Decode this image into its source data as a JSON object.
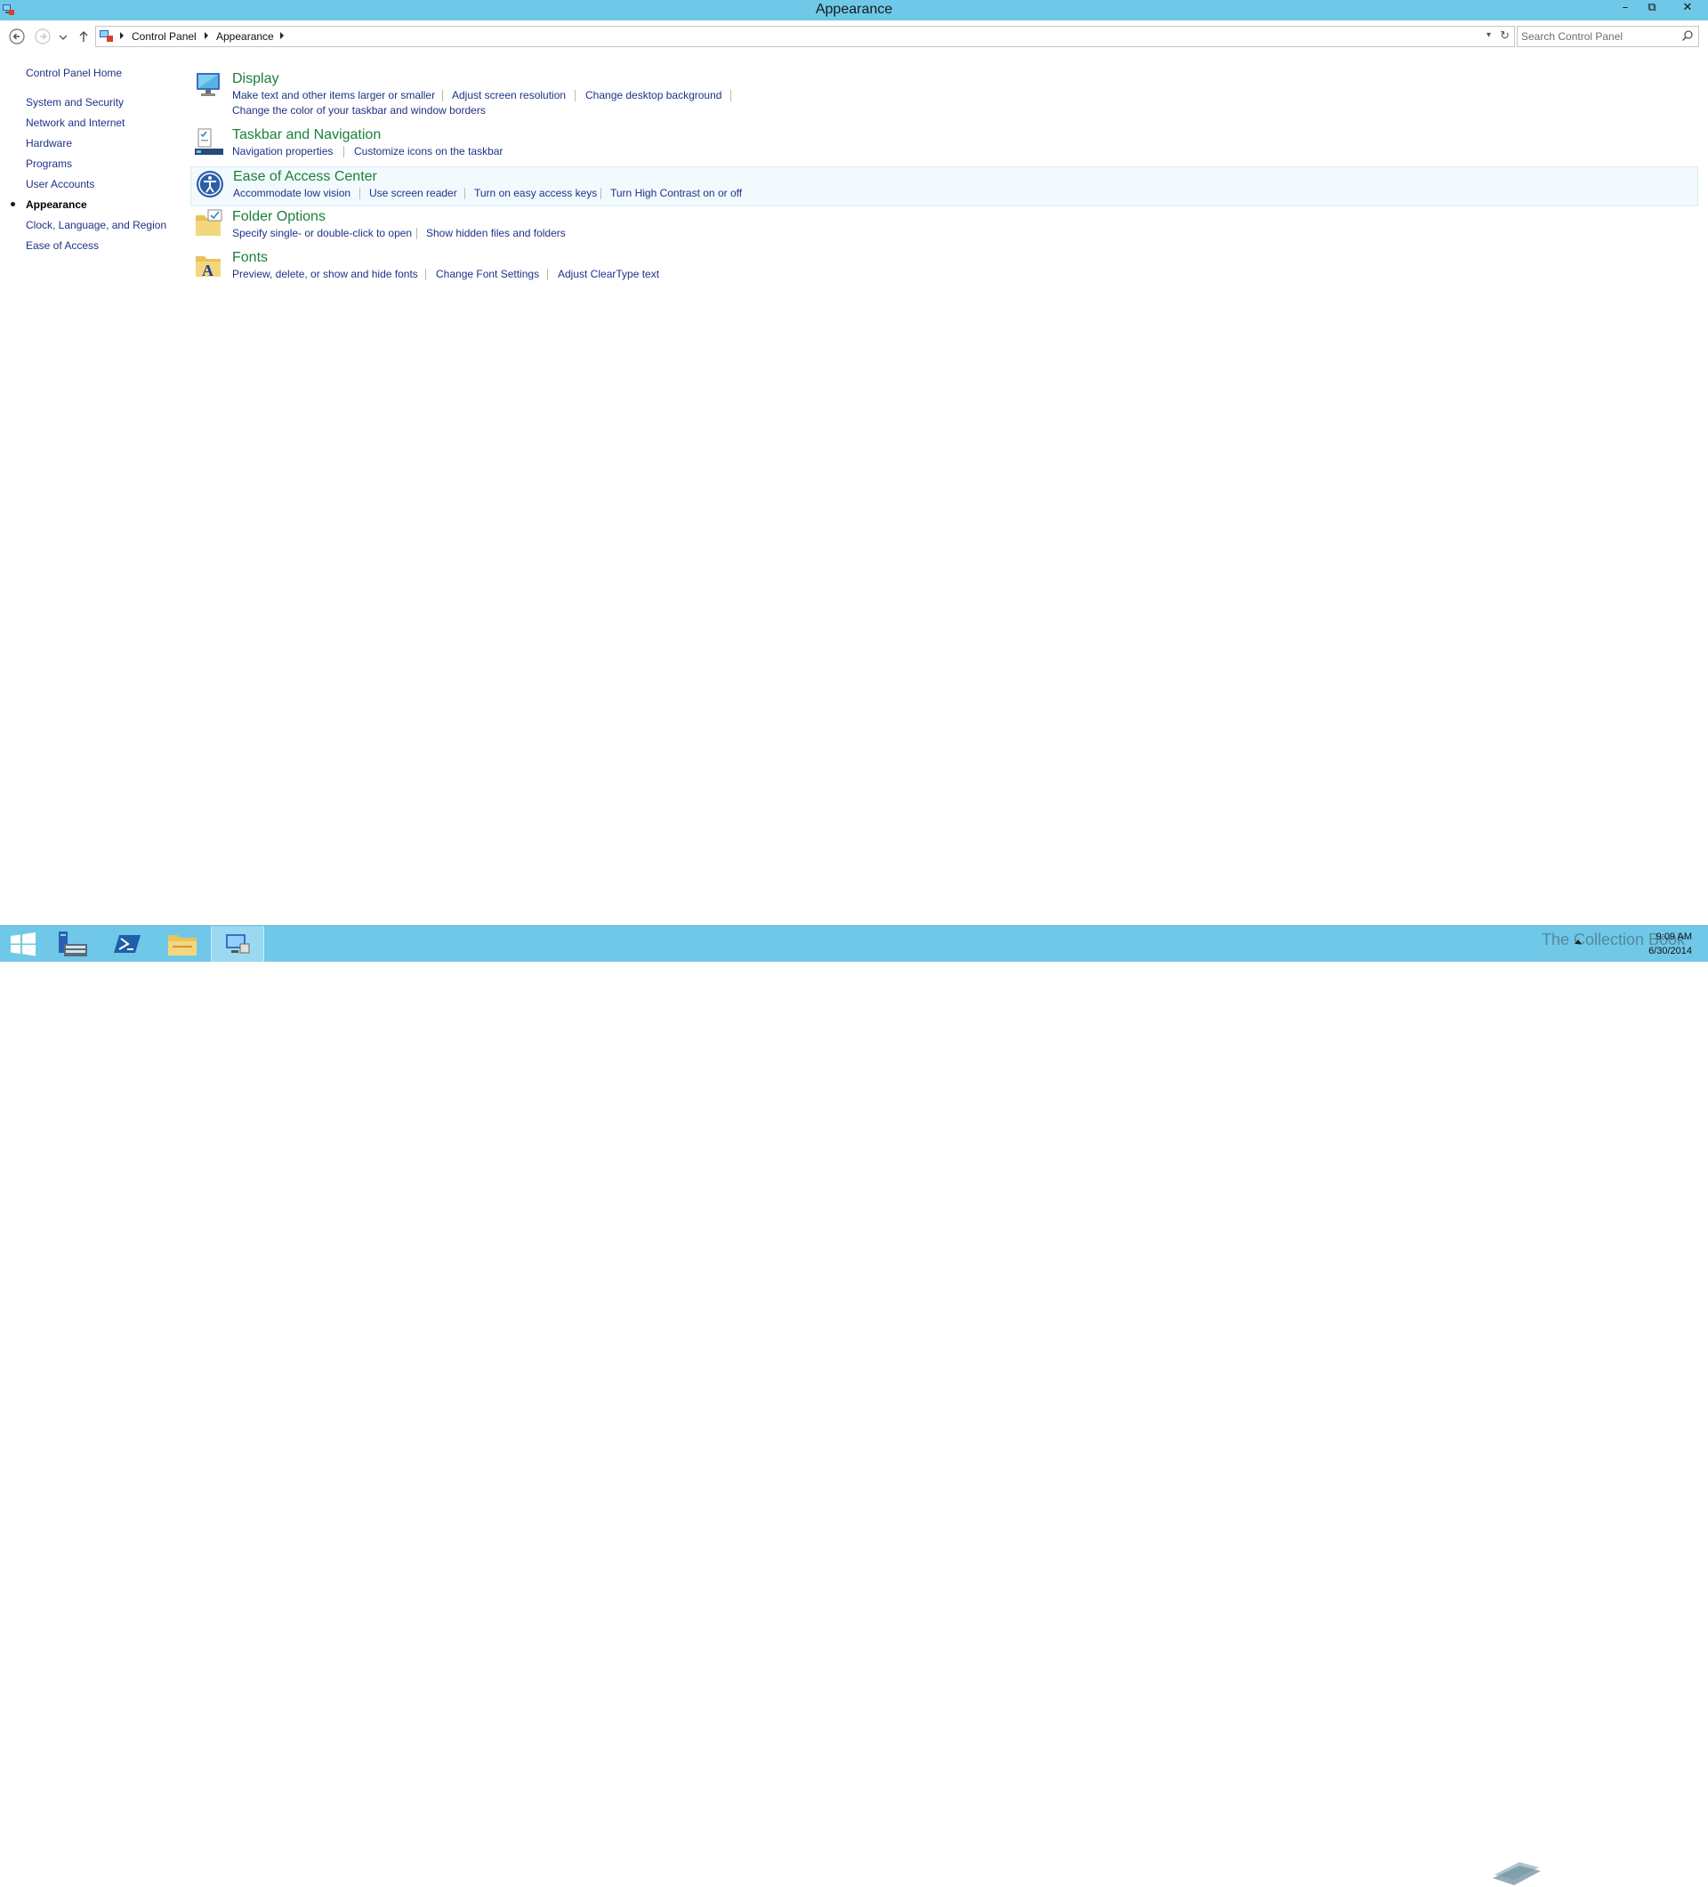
{
  "window": {
    "title": "Appearance",
    "minimize": "–",
    "restore": "⧉",
    "close": "✕"
  },
  "address_bar": {
    "breadcrumb": [
      "Control Panel",
      "Appearance"
    ]
  },
  "search": {
    "placeholder": "Search Control Panel",
    "value": ""
  },
  "left_nav": {
    "home": "Control Panel Home",
    "items": [
      {
        "label": "System and Security"
      },
      {
        "label": "Network and Internet"
      },
      {
        "label": "Hardware"
      },
      {
        "label": "Programs"
      },
      {
        "label": "User Accounts"
      },
      {
        "label": "Appearance",
        "current": true
      },
      {
        "label": "Clock, Language, and Region"
      },
      {
        "label": "Ease of Access"
      }
    ]
  },
  "categories": [
    {
      "title": "Display",
      "icon": "display-icon",
      "links": [
        "Make text and other items larger or smaller",
        "Adjust screen resolution",
        "Change desktop background",
        "Change the color of your taskbar and window borders"
      ]
    },
    {
      "title": "Taskbar and Navigation",
      "icon": "taskbar-icon",
      "links": [
        "Navigation properties",
        "Customize icons on the taskbar"
      ]
    },
    {
      "title": "Ease of Access Center",
      "icon": "ease-of-access-icon",
      "links": [
        "Accommodate low vision",
        "Use screen reader",
        "Turn on easy access keys",
        "Turn High Contrast on or off"
      ]
    },
    {
      "title": "Folder Options",
      "icon": "folder-options-icon",
      "links": [
        "Specify single- or double-click to open",
        "Show hidden files and folders"
      ]
    },
    {
      "title": "Fonts",
      "icon": "fonts-icon",
      "links": [
        "Preview, delete, or show and hide fonts",
        "Change Font Settings",
        "Adjust ClearType text"
      ]
    }
  ],
  "taskbar": {
    "buttons": [
      "start-icon",
      "server-manager-icon",
      "powershell-icon",
      "file-explorer-icon",
      "control-panel-icon"
    ],
    "watermark": "The Collection Book",
    "time": "9:09 AM",
    "date": "6/30/2014"
  },
  "colors": {
    "titlebar": "#6fc8e8",
    "link": "#1e3287",
    "category_title": "#19803a"
  }
}
